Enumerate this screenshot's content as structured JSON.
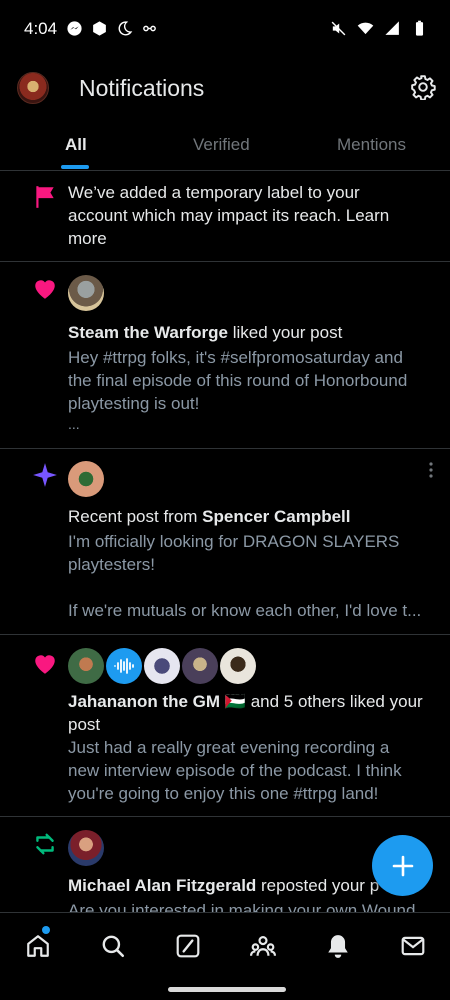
{
  "status_bar": {
    "time": "4:04"
  },
  "header": {
    "title": "Notifications"
  },
  "tabs": [
    "All",
    "Verified",
    "Mentions"
  ],
  "notifications": [
    {
      "type": "flag",
      "lines": [
        "We’ve added a temporary label to your",
        "account which may impact its reach. Learn",
        "more"
      ]
    },
    {
      "type": "like",
      "actor": "Steam the Warforge",
      "action": " liked your post",
      "preview": [
        "Hey #ttrpg folks, it's #selfpromosaturday and",
        "the final episode of this round of Honorbound",
        "playtesting is out!",
        "..."
      ]
    },
    {
      "type": "recent",
      "prefix": "Recent post from ",
      "actor": "Spencer Campbell",
      "preview": [
        "I'm officially looking for DRAGON SLAYERS",
        "playtesters!",
        "",
        "If we're mutuals or know each other, I'd love t..."
      ]
    },
    {
      "type": "like",
      "actor": "Jahananon the GM 🇵🇸",
      "action": " and 5 others liked your",
      "action2": "post",
      "preview": [
        "Just had a really great evening recording a",
        "new interview episode of the podcast. I think",
        "you're going to enjoy this one #ttrpg land!"
      ]
    },
    {
      "type": "repost",
      "actor": "Michael Alan Fitzgerald",
      "action": " reposted your p",
      "preview": [
        "Are you interested in making your own Wound"
      ]
    }
  ],
  "colors": {
    "accent": "#1d9bf0",
    "like": "#f91880",
    "repost": "#00ba7c",
    "sparkle": "#7856ff",
    "text": "#e7e9ea",
    "muted": "#8b98a5"
  },
  "icons": {
    "nav": [
      "home-icon",
      "search-icon",
      "grok-icon",
      "communities-icon",
      "notifications-icon",
      "messages-icon"
    ],
    "fab": "plus-icon"
  }
}
